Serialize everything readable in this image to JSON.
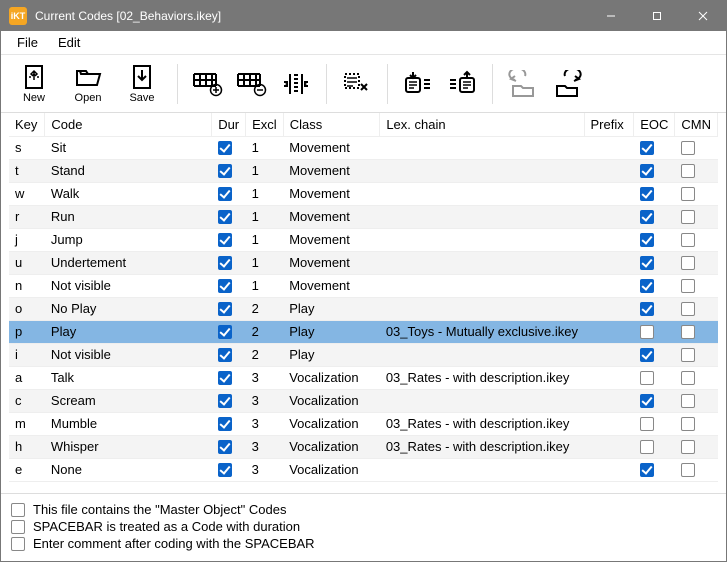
{
  "window": {
    "title": "Current Codes [02_Behaviors.ikey]"
  },
  "menubar": {
    "file": "File",
    "edit": "Edit"
  },
  "toolbar": {
    "new": "New",
    "open": "Open",
    "save": "Save"
  },
  "headers": {
    "key": "Key",
    "code": "Code",
    "dur": "Dur",
    "excl": "Excl",
    "class": "Class",
    "lex": "Lex. chain",
    "prefix": "Prefix",
    "eoc": "EOC",
    "cmn": "CMN"
  },
  "rows": [
    {
      "key": "s",
      "code": "Sit",
      "dur": true,
      "excl": "1",
      "class": "Movement",
      "lex": "",
      "prefix": "",
      "eoc": true,
      "cmn": false,
      "sel": false
    },
    {
      "key": "t",
      "code": "Stand",
      "dur": true,
      "excl": "1",
      "class": "Movement",
      "lex": "",
      "prefix": "",
      "eoc": true,
      "cmn": false,
      "sel": false
    },
    {
      "key": "w",
      "code": "Walk",
      "dur": true,
      "excl": "1",
      "class": "Movement",
      "lex": "",
      "prefix": "",
      "eoc": true,
      "cmn": false,
      "sel": false
    },
    {
      "key": "r",
      "code": "Run",
      "dur": true,
      "excl": "1",
      "class": "Movement",
      "lex": "",
      "prefix": "",
      "eoc": true,
      "cmn": false,
      "sel": false
    },
    {
      "key": "j",
      "code": "Jump",
      "dur": true,
      "excl": "1",
      "class": "Movement",
      "lex": "",
      "prefix": "",
      "eoc": true,
      "cmn": false,
      "sel": false
    },
    {
      "key": "u",
      "code": "Undertement",
      "dur": true,
      "excl": "1",
      "class": "Movement",
      "lex": "",
      "prefix": "",
      "eoc": true,
      "cmn": false,
      "sel": false
    },
    {
      "key": "n",
      "code": "Not visible",
      "dur": true,
      "excl": "1",
      "class": "Movement",
      "lex": "",
      "prefix": "",
      "eoc": true,
      "cmn": false,
      "sel": false
    },
    {
      "key": "o",
      "code": "No Play",
      "dur": true,
      "excl": "2",
      "class": "Play",
      "lex": "",
      "prefix": "",
      "eoc": true,
      "cmn": false,
      "sel": false
    },
    {
      "key": "p",
      "code": "Play",
      "dur": true,
      "excl": "2",
      "class": "Play",
      "lex": "03_Toys - Mutually exclusive.ikey",
      "prefix": "",
      "eoc": false,
      "cmn": false,
      "sel": true
    },
    {
      "key": "i",
      "code": "Not visible",
      "dur": true,
      "excl": "2",
      "class": "Play",
      "lex": "",
      "prefix": "",
      "eoc": true,
      "cmn": false,
      "sel": false
    },
    {
      "key": "a",
      "code": "Talk",
      "dur": true,
      "excl": "3",
      "class": "Vocalization",
      "lex": "03_Rates - with description.ikey",
      "prefix": "",
      "eoc": false,
      "cmn": false,
      "sel": false
    },
    {
      "key": "c",
      "code": "Scream",
      "dur": true,
      "excl": "3",
      "class": "Vocalization",
      "lex": "",
      "prefix": "",
      "eoc": true,
      "cmn": false,
      "sel": false
    },
    {
      "key": "m",
      "code": "Mumble",
      "dur": true,
      "excl": "3",
      "class": "Vocalization",
      "lex": "03_Rates - with description.ikey",
      "prefix": "",
      "eoc": false,
      "cmn": false,
      "sel": false
    },
    {
      "key": "h",
      "code": "Whisper",
      "dur": true,
      "excl": "3",
      "class": "Vocalization",
      "lex": "03_Rates - with description.ikey",
      "prefix": "",
      "eoc": false,
      "cmn": false,
      "sel": false
    },
    {
      "key": "e",
      "code": "None",
      "dur": true,
      "excl": "3",
      "class": "Vocalization",
      "lex": "",
      "prefix": "",
      "eoc": true,
      "cmn": false,
      "sel": false
    }
  ],
  "footer": {
    "master": "This file contains the \"Master Object\" Codes",
    "spacebar": "SPACEBAR is treated as a Code with duration",
    "comment": "Enter comment after coding with the SPACEBAR",
    "master_on": false,
    "spacebar_on": false,
    "comment_on": false
  }
}
